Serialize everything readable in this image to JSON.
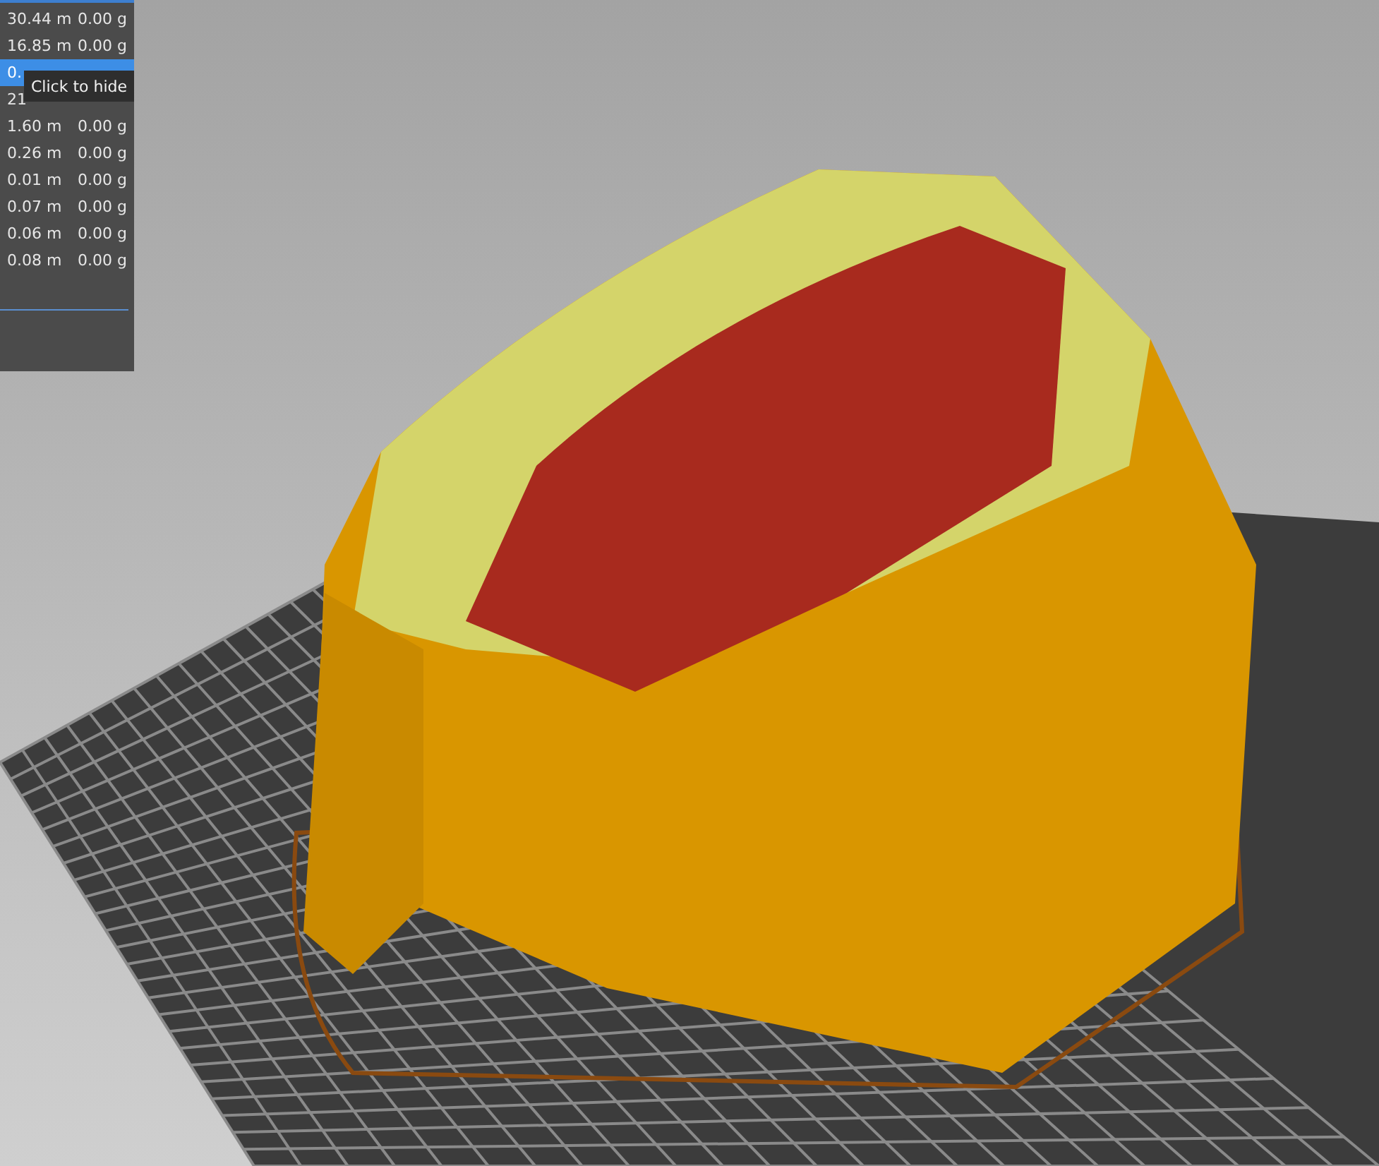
{
  "legend": {
    "rows": [
      {
        "length": "30.44 m",
        "weight": "0.00 g",
        "selected": false
      },
      {
        "length": "16.85 m",
        "weight": "0.00 g",
        "selected": false
      },
      {
        "length": "0.",
        "selected": true
      },
      {
        "length": "21",
        "selected": false
      },
      {
        "length": "1.60 m",
        "weight": "0.00 g",
        "selected": false
      },
      {
        "length": "0.26 m",
        "weight": "0.00 g",
        "selected": false
      },
      {
        "length": "0.01 m",
        "weight": "0.00 g",
        "selected": false
      },
      {
        "length": "0.07 m",
        "weight": "0.00 g",
        "selected": false
      },
      {
        "length": "0.06 m",
        "weight": "0.00 g",
        "selected": false
      },
      {
        "length": "0.08 m",
        "weight": "0.00 g",
        "selected": false
      }
    ]
  },
  "tooltip": {
    "text": "Click to hide"
  }
}
